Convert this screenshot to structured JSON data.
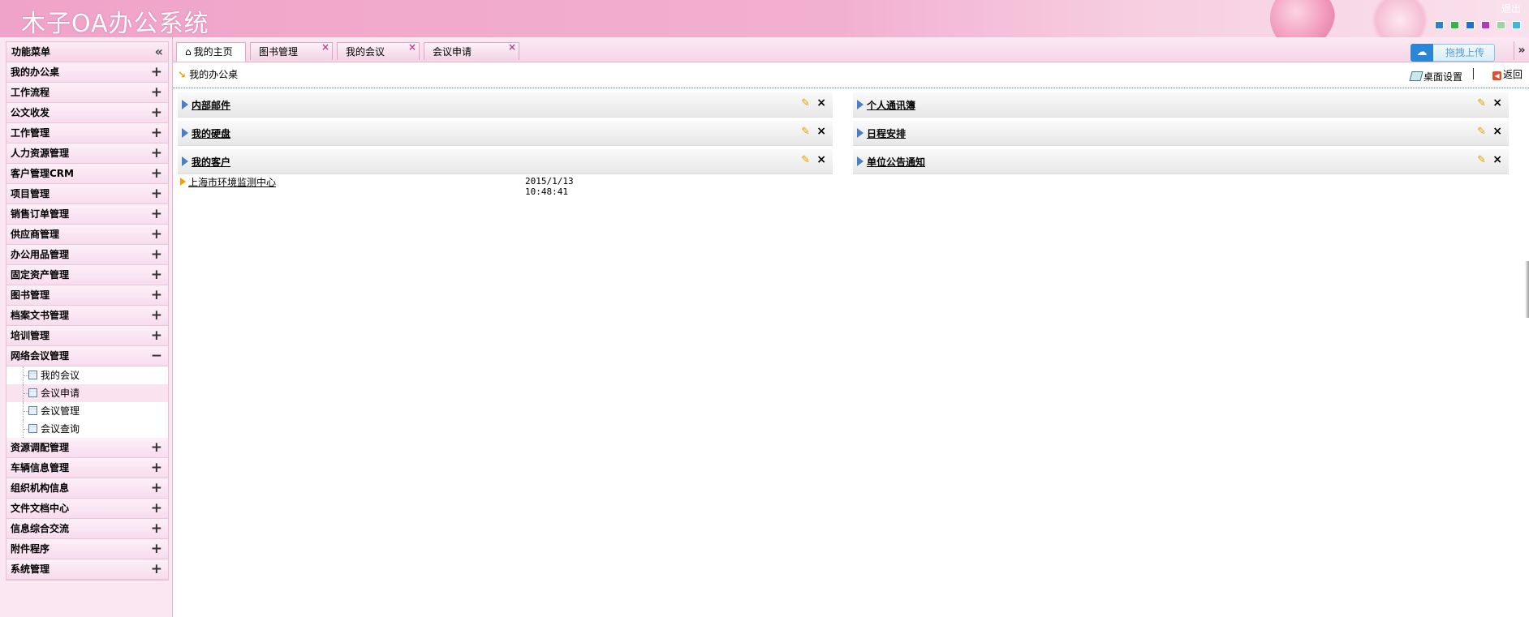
{
  "header": {
    "app_title": "木子OA办公系统",
    "logout_label": "退出",
    "theme_swatches": [
      "#2f7fd0",
      "#39b24a",
      "#1d6fd6",
      "#b13bb6",
      "#9fd3a0",
      "#41b7d8"
    ]
  },
  "sidebar": {
    "title": "功能菜单",
    "collapse_icon": "double-chevron-left-icon",
    "items_before": [
      {
        "label": "我的办公桌"
      },
      {
        "label": "工作流程"
      },
      {
        "label": "公文收发"
      },
      {
        "label": "工作管理"
      },
      {
        "label": "人力资源管理"
      },
      {
        "label": "客户管理CRM"
      },
      {
        "label": "项目管理"
      },
      {
        "label": "销售订单管理"
      },
      {
        "label": "供应商管理"
      },
      {
        "label": "办公用品管理"
      },
      {
        "label": "固定资产管理"
      },
      {
        "label": "图书管理"
      },
      {
        "label": "档案文书管理"
      },
      {
        "label": "培训管理"
      }
    ],
    "expanded_item": {
      "label": "网络会议管理",
      "children": [
        {
          "label": "我的会议",
          "active": false
        },
        {
          "label": "会议申请",
          "active": true
        },
        {
          "label": "会议管理",
          "active": false
        },
        {
          "label": "会议查询",
          "active": false
        }
      ]
    },
    "items_after": [
      {
        "label": "资源调配管理"
      },
      {
        "label": "车辆信息管理"
      },
      {
        "label": "组织机构信息"
      },
      {
        "label": "文件文档中心"
      },
      {
        "label": "信息综合交流"
      },
      {
        "label": "附件程序"
      },
      {
        "label": "系统管理"
      }
    ]
  },
  "tabs": [
    {
      "label": "我的主页",
      "active": true,
      "icon": "home-icon"
    },
    {
      "label": "图书管理",
      "active": false
    },
    {
      "label": "我的会议",
      "active": false
    },
    {
      "label": "会议申请",
      "active": false
    }
  ],
  "upload_button": {
    "label": "拖拽上传",
    "icon": "cloud-icon"
  },
  "toolbar": {
    "breadcrumb": "我的办公桌",
    "desk_settings": "桌面设置",
    "back": "返回"
  },
  "panels_left": [
    {
      "title": "内部邮件"
    },
    {
      "title": "我的硬盘"
    },
    {
      "title": "我的客户"
    }
  ],
  "panels_right": [
    {
      "title": "个人通讯簿"
    },
    {
      "title": "日程安排"
    },
    {
      "title": "单位公告通知"
    }
  ],
  "client_entry": {
    "name": "上海市环境监测中心",
    "date": "2015/1/13 10:48:41"
  }
}
